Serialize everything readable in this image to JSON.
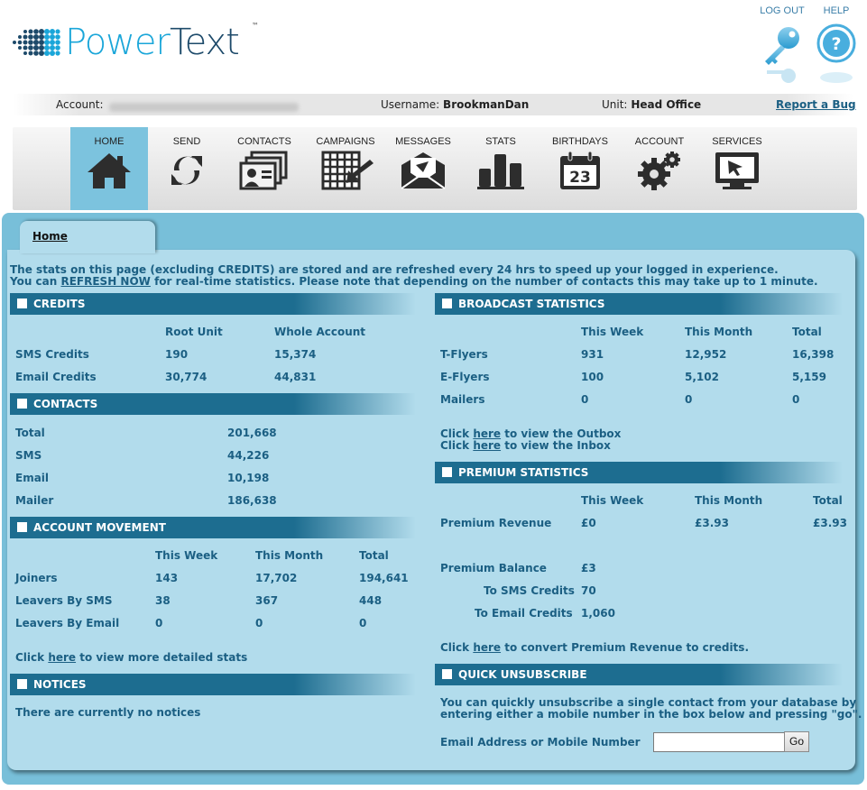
{
  "brand": {
    "name_part1": "Power",
    "name_part2": "Text",
    "tm": "™"
  },
  "top_links": {
    "logout": "LOG OUT",
    "help": "HELP"
  },
  "infobar": {
    "account_label": "Account:",
    "username_label": "Username:",
    "username": "BrookmanDan",
    "unit_label": "Unit:",
    "unit": "Head Office",
    "report_bug": "Report a Bug"
  },
  "nav": {
    "items": [
      {
        "label": "HOME",
        "icon": "home-icon"
      },
      {
        "label": "SEND",
        "icon": "send-icon"
      },
      {
        "label": "CONTACTS",
        "icon": "contacts-icon"
      },
      {
        "label": "CAMPAIGNS",
        "icon": "campaigns-icon"
      },
      {
        "label": "MESSAGES",
        "icon": "messages-icon"
      },
      {
        "label": "STATS",
        "icon": "stats-icon"
      },
      {
        "label": "BIRTHDAYS",
        "icon": "birthdays-icon"
      },
      {
        "label": "ACCOUNT",
        "icon": "account-icon"
      },
      {
        "label": "SERVICES",
        "icon": "services-icon"
      }
    ],
    "birthday_day": "23"
  },
  "tab": {
    "label": "Home"
  },
  "intro": {
    "line1": "The stats on this page (excluding CREDITS) are stored and are refreshed every 24 hrs to speed up your logged in experience.",
    "line2_pre": "You can ",
    "line2_link": "REFRESH NOW",
    "line2_post": " for real-time statistics. Please note that depending on the number of contacts this may take up to 1 minute."
  },
  "credits": {
    "title": "CREDITS",
    "cols": [
      "Root Unit",
      "Whole Account"
    ],
    "rows": [
      {
        "label": "SMS Credits",
        "values": [
          "190",
          "15,374"
        ]
      },
      {
        "label": "Email Credits",
        "values": [
          "30,774",
          "44,831"
        ]
      }
    ]
  },
  "contacts": {
    "title": "CONTACTS",
    "rows": [
      {
        "label": "Total",
        "value": "201,668"
      },
      {
        "label": "SMS",
        "value": "44,226"
      },
      {
        "label": "Email",
        "value": "10,198"
      },
      {
        "label": "Mailer",
        "value": "186,638"
      }
    ]
  },
  "movement": {
    "title": "ACCOUNT MOVEMENT",
    "cols": [
      "This Week",
      "This Month",
      "Total"
    ],
    "rows": [
      {
        "label": "Joiners",
        "values": [
          "143",
          "17,702",
          "194,641"
        ]
      },
      {
        "label": "Leavers By SMS",
        "values": [
          "38",
          "367",
          "448"
        ]
      },
      {
        "label": "Leavers By Email",
        "values": [
          "0",
          "0",
          "0"
        ]
      }
    ],
    "more_pre": "Click ",
    "more_link": "here",
    "more_post": " to view more detailed stats"
  },
  "notices": {
    "title": "NOTICES",
    "text": "There are currently no notices"
  },
  "broadcast": {
    "title": "BROADCAST STATISTICS",
    "cols": [
      "This Week",
      "This Month",
      "Total"
    ],
    "rows": [
      {
        "label": "T-Flyers",
        "values": [
          "931",
          "12,952",
          "16,398"
        ]
      },
      {
        "label": "E-Flyers",
        "values": [
          "100",
          "5,102",
          "5,159"
        ]
      },
      {
        "label": "Mailers",
        "values": [
          "0",
          "0",
          "0"
        ]
      }
    ],
    "outbox_pre": "Click ",
    "outbox_link": "here",
    "outbox_post": " to view the Outbox",
    "inbox_pre": "Click ",
    "inbox_link": "here",
    "inbox_post": " to view the Inbox"
  },
  "premium": {
    "title": "PREMIUM STATISTICS",
    "cols": [
      "This Week",
      "This Month",
      "Total"
    ],
    "revenue_label": "Premium Revenue",
    "revenue_values": [
      "£0",
      "£3.93",
      "£3.93"
    ],
    "balance_label": "Premium Balance",
    "balance_value": "£3",
    "to_sms_label": "To SMS Credits",
    "to_sms_value": "70",
    "to_email_label": "To Email Credits",
    "to_email_value": "1,060",
    "convert_pre": "Click ",
    "convert_link": "here",
    "convert_post": " to convert Premium Revenue to credits."
  },
  "unsubscribe": {
    "title": "QUICK UNSUBSCRIBE",
    "line1": "You can quickly unsubscribe a single contact from your database by",
    "line2": "entering either a mobile number in the box below and pressing \"go\".",
    "field_label": "Email Address or Mobile Number",
    "input_value": "",
    "go_label": "Go"
  },
  "colors": {
    "accent": "#1aa6d9",
    "section_header": "#1d6d90",
    "panel_bg": "#b2dcec",
    "panel_outer": "#78bfd9",
    "text": "#1b5f83"
  }
}
